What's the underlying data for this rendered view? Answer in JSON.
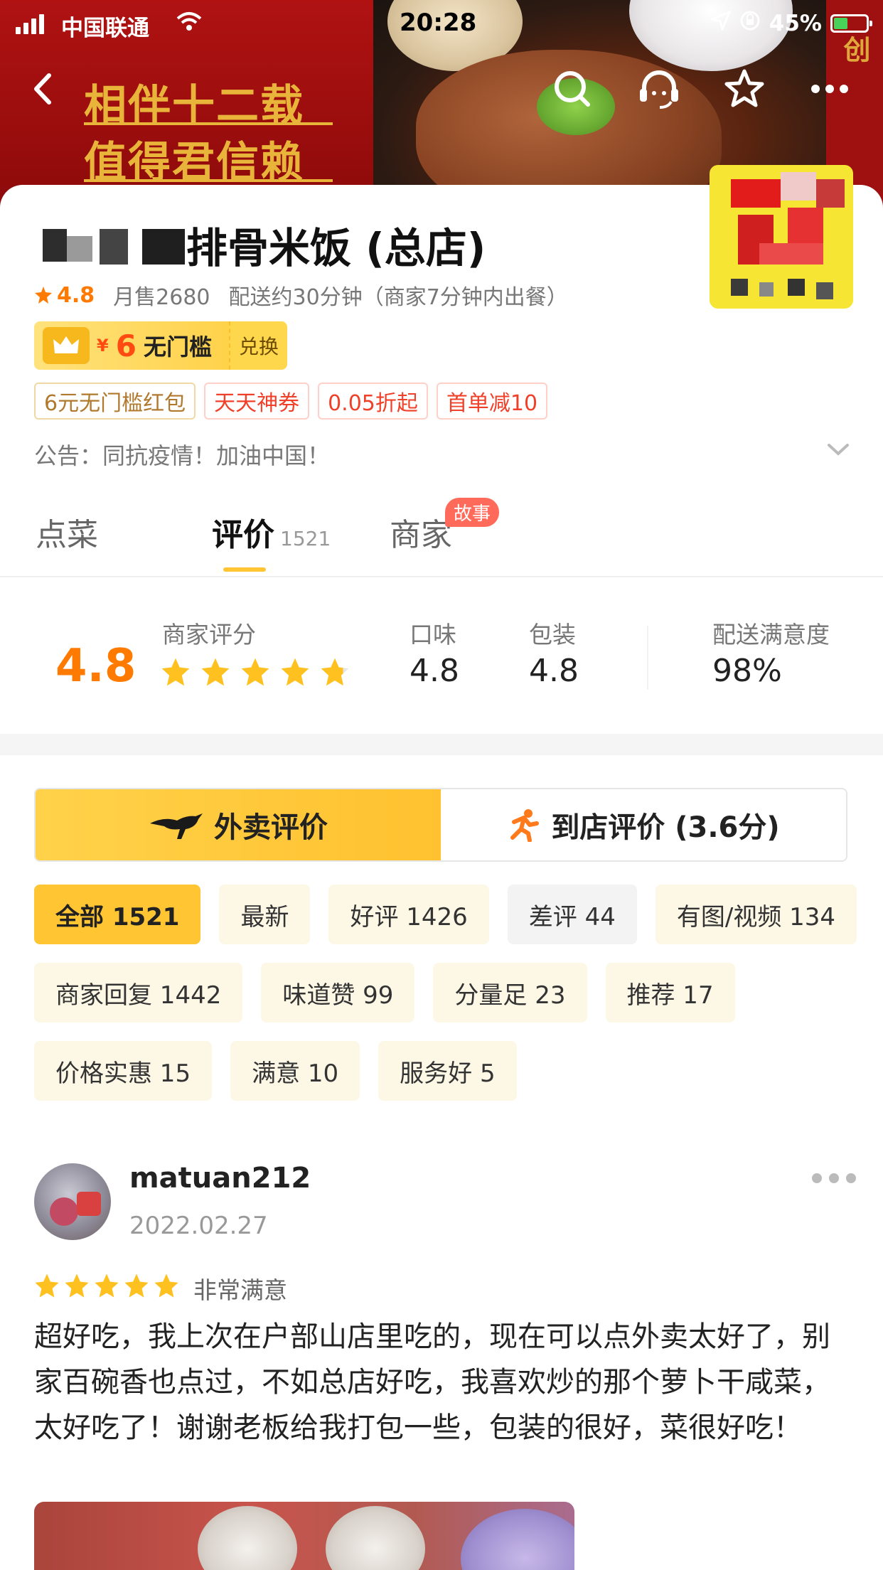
{
  "status_bar": {
    "carrier": "中国联通",
    "time": "20:28",
    "battery": "45%",
    "battery_level": 0.45
  },
  "banner": {
    "slogan_line1": "相伴十二载",
    "slogan_line2": "值得君信赖",
    "side_text": "创"
  },
  "nav": {
    "icons": [
      "back-icon",
      "search-icon",
      "customer-service-icon",
      "star-icon",
      "more-icon"
    ]
  },
  "shop": {
    "name": "排骨米饭 (总店)",
    "rating": "4.8",
    "monthly_sales": "月售2680",
    "delivery": "配送约30分钟（商家7分钟内出餐）",
    "coupon": {
      "currency": "¥",
      "amount": "6",
      "condition": "无门槛",
      "action": "兑换"
    },
    "tags": [
      {
        "label": "6元无门槛红包",
        "style": "gold"
      },
      {
        "label": "天天神券",
        "style": "red"
      },
      {
        "label": "0.05折起",
        "style": "red"
      },
      {
        "label": "首单减10",
        "style": "red"
      }
    ],
    "notice": "公告：同抗疫情！加油中国！"
  },
  "tabs": {
    "menu": "点菜",
    "reviews": "评价",
    "reviews_count": "1521",
    "merchant": "商家",
    "merchant_badge": "故事"
  },
  "scores": {
    "overall": "4.8",
    "overall_label": "商家评分",
    "overall_stars": 4.8,
    "taste_label": "口味",
    "taste_value": "4.8",
    "package_label": "包装",
    "package_value": "4.8",
    "delivery_label": "配送满意度",
    "delivery_value": "98%"
  },
  "segment": {
    "takeout": "外卖评价",
    "dinein": "到店评价 (3.6分)"
  },
  "filters": [
    {
      "label": "全部 1521",
      "state": "active"
    },
    {
      "label": "最新",
      "state": "normal"
    },
    {
      "label": "好评 1426",
      "state": "normal"
    },
    {
      "label": "差评 44",
      "state": "gray"
    },
    {
      "label": "有图/视频 134",
      "state": "normal"
    },
    {
      "label": "商家回复 1442",
      "state": "normal"
    },
    {
      "label": "味道赞 99",
      "state": "normal"
    },
    {
      "label": "分量足 23",
      "state": "normal"
    },
    {
      "label": "推荐 17",
      "state": "normal"
    },
    {
      "label": "价格实惠 15",
      "state": "normal"
    },
    {
      "label": "满意 10",
      "state": "normal"
    },
    {
      "label": "服务好 5",
      "state": "normal"
    }
  ],
  "review": {
    "username": "matuan212",
    "date": "2022.02.27",
    "stars": 5,
    "level": "非常满意",
    "text": "超好吃，我上次在户部山店里吃的，现在可以点外卖太好了，别家百碗香也点过，不如总店好吃，我喜欢炒的那个萝卜干咸菜，太好吃了！谢谢老板给我打包一些，包装的很好，菜很好吃！"
  },
  "colors": {
    "accent_yellow": "#ffc533",
    "rating_orange": "#ff7a00",
    "banner_red": "#a30d0d",
    "coupon_red": "#ff4b12"
  }
}
